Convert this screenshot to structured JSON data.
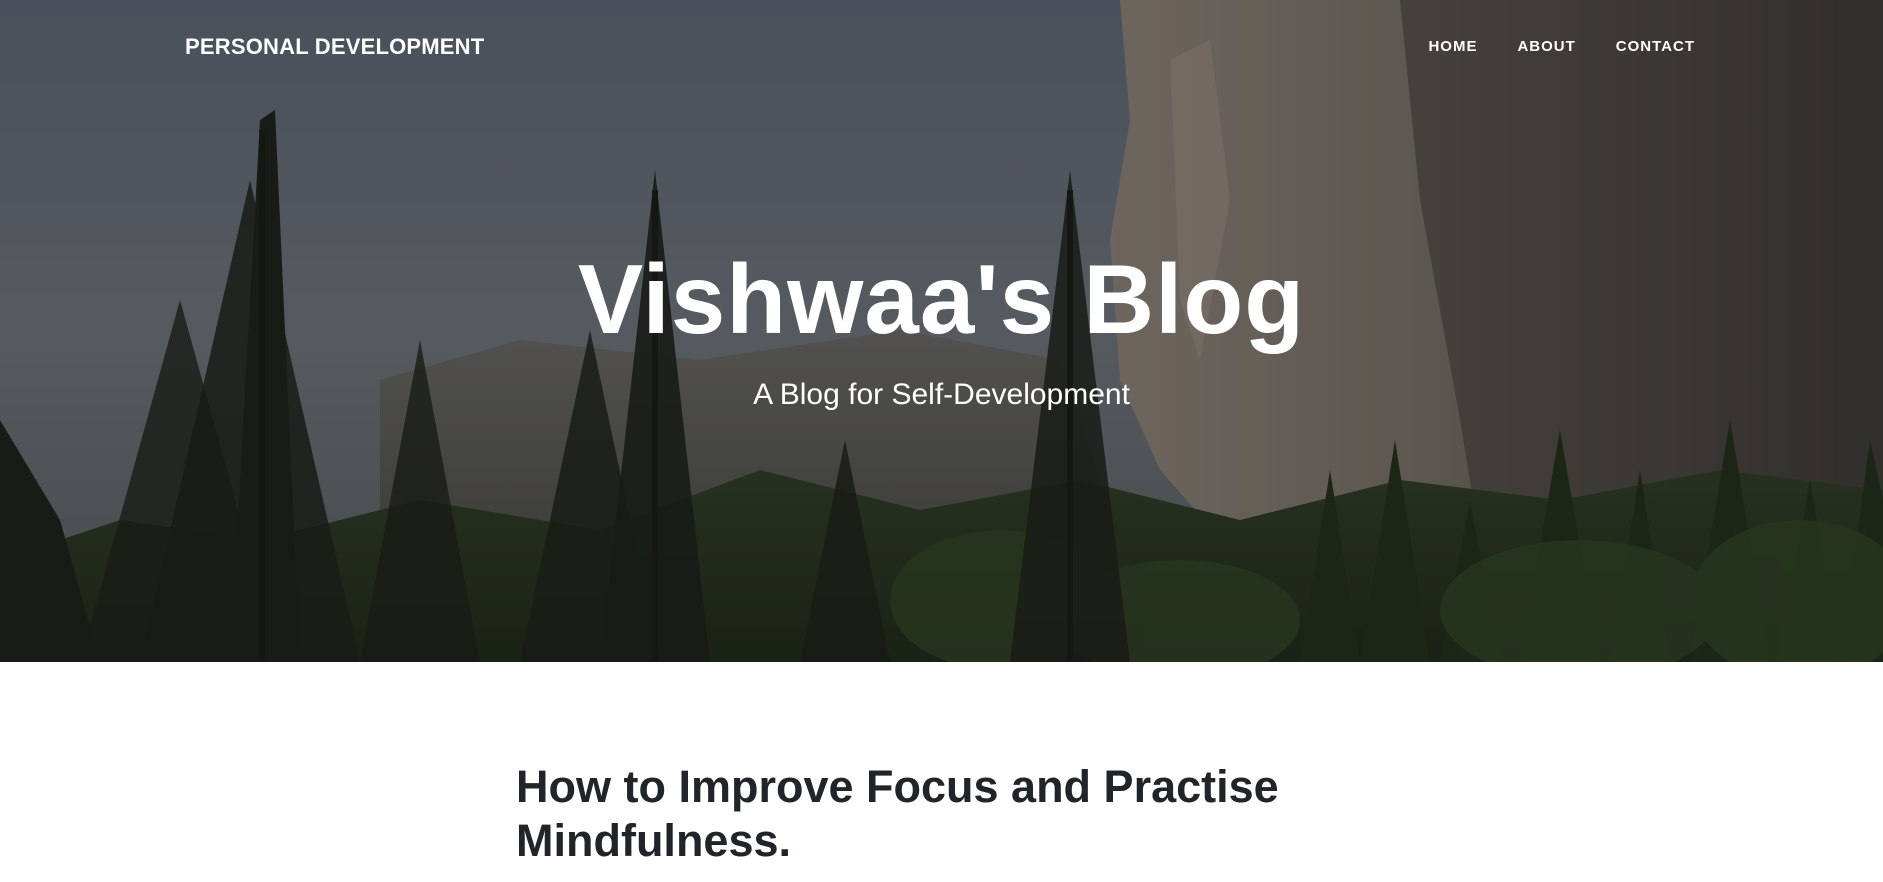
{
  "header": {
    "brand": "PERSONAL DEVELOPMENT",
    "nav": [
      {
        "label": "HOME"
      },
      {
        "label": "ABOUT"
      },
      {
        "label": "CONTACT"
      }
    ]
  },
  "hero": {
    "title": "Vishwaa's Blog",
    "subtitle": "A Blog for Self-Development"
  },
  "main": {
    "post_title": "How to Improve Focus and Practise Mindfulness."
  },
  "colors": {
    "nav_text": "#ffffff",
    "post_title": "#212529",
    "page_bg": "#ffffff"
  }
}
